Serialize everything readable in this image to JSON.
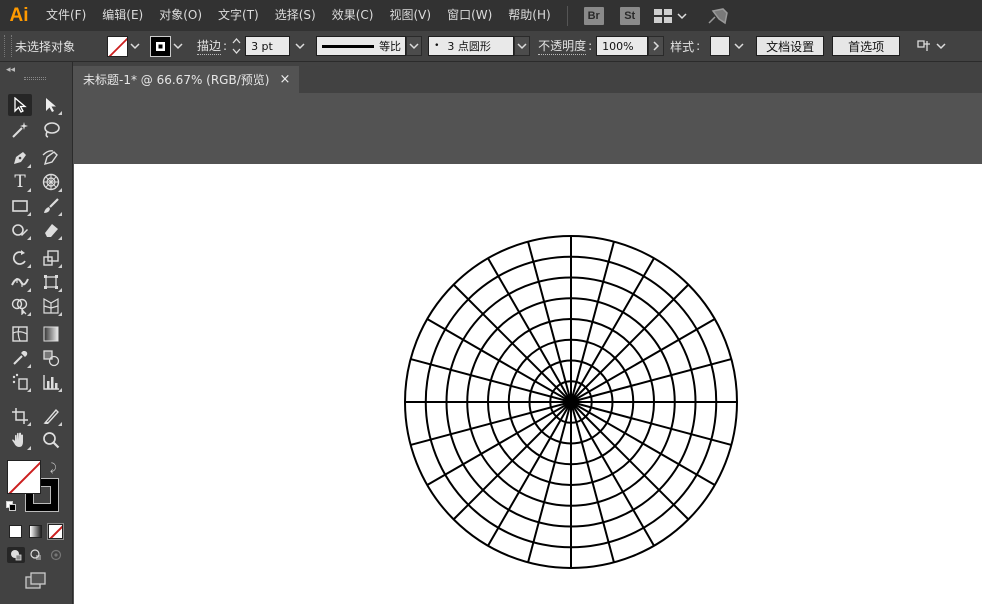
{
  "app": {
    "logo": "Ai",
    "menus": [
      "文件(F)",
      "编辑(E)",
      "对象(O)",
      "文字(T)",
      "选择(S)",
      "效果(C)",
      "视图(V)",
      "窗口(W)",
      "帮助(H)"
    ],
    "bridge_badge": "Br",
    "stock_badge": "St"
  },
  "control_bar": {
    "selection_status": "未选择对象",
    "stroke_label": "描边",
    "stroke_weight": "3 pt",
    "profile_label": "等比",
    "brush_label": "3 点圆形",
    "brush_dot": "•",
    "opacity_label": "不透明度",
    "opacity_value": "100%",
    "style_label": "样式",
    "doc_setup_button": "文档设置",
    "preferences_button": "首选项"
  },
  "document": {
    "tab_title": "未标题-1* @ 66.67% (RGB/预览)",
    "close_symbol": "×"
  },
  "artwork": {
    "type": "polar-grid",
    "concentric_rings": 8,
    "radial_dividers": 24,
    "stroke_color": "#000000",
    "fill_color": "none"
  },
  "colors": {
    "menubar_bg": "#323232",
    "panel_bg": "#424242",
    "canvas_bg": "#535353",
    "logo_color": "#ff9a00",
    "no_fill_slash": "#cc1f1f"
  }
}
